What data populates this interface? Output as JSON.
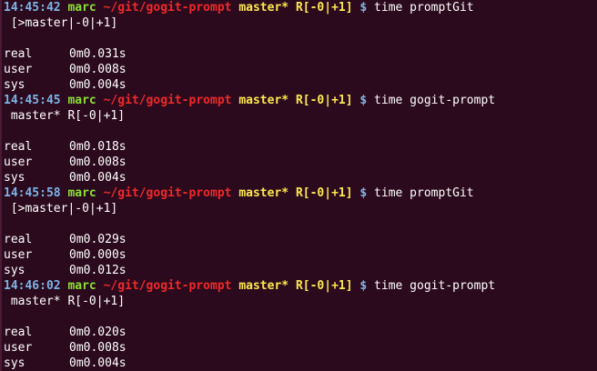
{
  "colors": {
    "background": "#2c0a1e",
    "time": "#7db4e6",
    "user": "#8ae234",
    "path": "#ef2929",
    "branch": "#fce94f",
    "text": "#ffffff"
  },
  "blocks": [
    {
      "time": "14:45:42",
      "user": "marc",
      "path": "~/git/gogit-prompt",
      "branch": "master*",
      "status": "R[-0|+1]",
      "dollar": "$",
      "command": "time promptGit",
      "output": " [>master|-0|+1]",
      "timing": [
        {
          "label": "real",
          "value": "0m0.031s"
        },
        {
          "label": "user",
          "value": "0m0.008s"
        },
        {
          "label": "sys",
          "value": "0m0.004s"
        }
      ]
    },
    {
      "time": "14:45:45",
      "user": "marc",
      "path": "~/git/gogit-prompt",
      "branch": "master*",
      "status": "R[-0|+1]",
      "dollar": "$",
      "command": "time gogit-prompt",
      "output": " master* R[-0|+1]",
      "timing": [
        {
          "label": "real",
          "value": "0m0.018s"
        },
        {
          "label": "user",
          "value": "0m0.008s"
        },
        {
          "label": "sys",
          "value": "0m0.004s"
        }
      ]
    },
    {
      "time": "14:45:58",
      "user": "marc",
      "path": "~/git/gogit-prompt",
      "branch": "master*",
      "status": "R[-0|+1]",
      "dollar": "$",
      "command": "time promptGit",
      "output": " [>master|-0|+1]",
      "timing": [
        {
          "label": "real",
          "value": "0m0.029s"
        },
        {
          "label": "user",
          "value": "0m0.000s"
        },
        {
          "label": "sys",
          "value": "0m0.012s"
        }
      ]
    },
    {
      "time": "14:46:02",
      "user": "marc",
      "path": "~/git/gogit-prompt",
      "branch": "master*",
      "status": "R[-0|+1]",
      "dollar": "$",
      "command": "time gogit-prompt",
      "output": " master* R[-0|+1]",
      "timing": [
        {
          "label": "real",
          "value": "0m0.020s"
        },
        {
          "label": "user",
          "value": "0m0.008s"
        },
        {
          "label": "sys",
          "value": "0m0.004s"
        }
      ]
    }
  ]
}
